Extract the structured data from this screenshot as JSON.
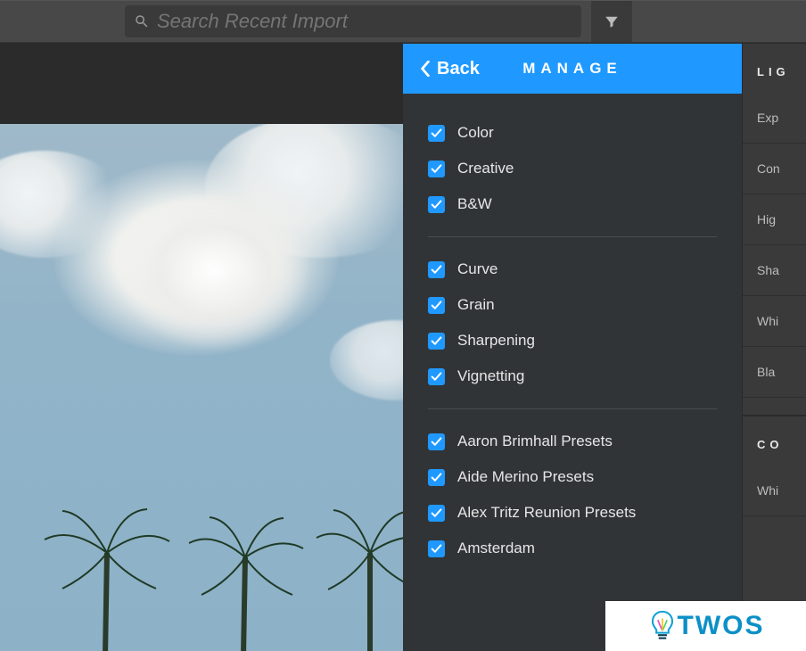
{
  "search": {
    "placeholder": "Search Recent Import",
    "value": ""
  },
  "filter_icon": "filter",
  "manage_panel": {
    "back_label": "Back",
    "title": "MANAGE",
    "groups": [
      {
        "items": [
          {
            "label": "Color",
            "checked": true
          },
          {
            "label": "Creative",
            "checked": true
          },
          {
            "label": "B&W",
            "checked": true
          }
        ]
      },
      {
        "items": [
          {
            "label": "Curve",
            "checked": true
          },
          {
            "label": "Grain",
            "checked": true
          },
          {
            "label": "Sharpening",
            "checked": true
          },
          {
            "label": "Vignetting",
            "checked": true
          }
        ]
      },
      {
        "items": [
          {
            "label": "Aaron Brimhall Presets",
            "checked": true
          },
          {
            "label": "Aide Merino Presets",
            "checked": true
          },
          {
            "label": "Alex Tritz Reunion Presets",
            "checked": true
          },
          {
            "label": "Amsterdam",
            "checked": true
          }
        ]
      }
    ]
  },
  "right_sidebar": {
    "section1_title": "LIG",
    "section1_rows": [
      "Exp",
      "Con",
      "Hig",
      "Sha",
      "Whi",
      "Bla"
    ],
    "section2_title": "CO",
    "section2_rows": [
      "Whi"
    ]
  },
  "watermark_text": "TWOS"
}
